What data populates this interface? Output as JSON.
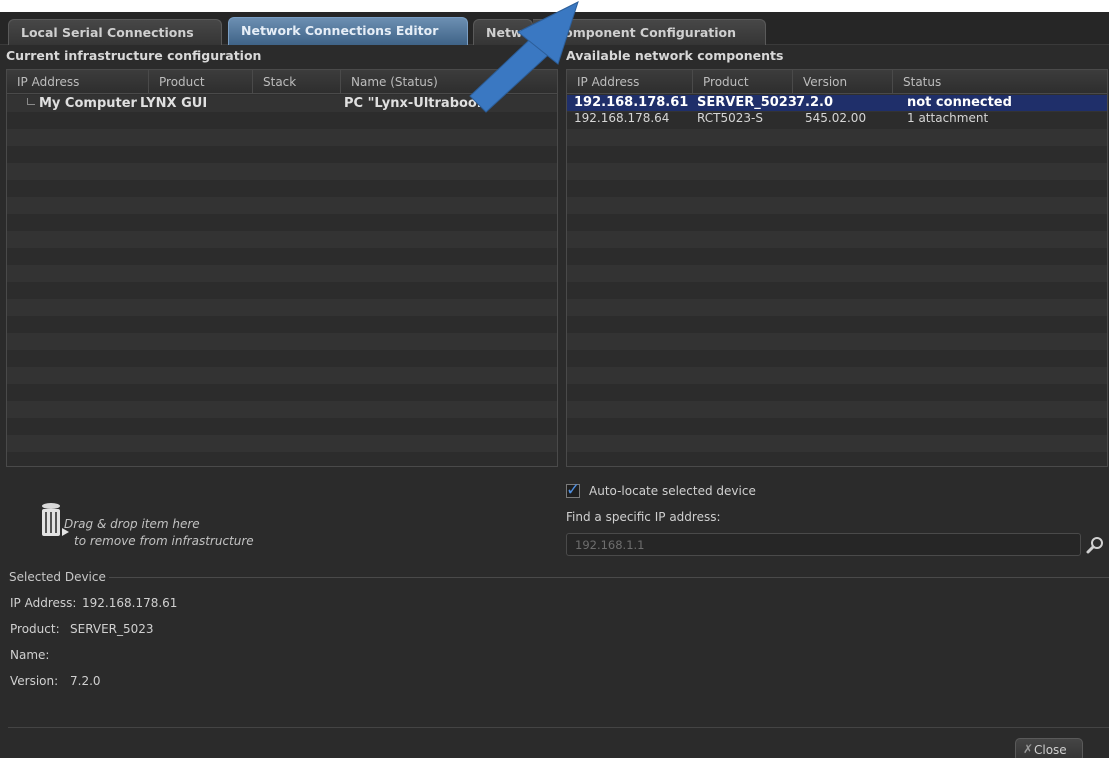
{
  "tabs": [
    {
      "label": "Local Serial Connections",
      "active": false
    },
    {
      "label": "Network Connections Editor",
      "active": true
    },
    {
      "label": "Netw",
      "active": false
    },
    {
      "label": "Component Configuration",
      "active": false
    }
  ],
  "left_panel": {
    "title": "Current infrastructure configuration",
    "columns": [
      "IP Address",
      "Product",
      "Stack",
      "Name (Status)"
    ],
    "rows": [
      {
        "ip": "My Computer",
        "product": "LYNX GUI",
        "stack": "",
        "name": "PC \"Lynx-Ultrabook\""
      }
    ]
  },
  "right_panel": {
    "title": "Available network components",
    "columns": [
      "IP Address",
      "Product",
      "Version",
      "Status"
    ],
    "rows": [
      {
        "ip": "192.168.178.61",
        "product": "SERVER_5023",
        "version": "7.2.0",
        "status": "not connected",
        "selected": true
      },
      {
        "ip": "192.168.178.64",
        "product": "RCT5023-S",
        "version": "545.02.00",
        "status": "1 attachment",
        "selected": false
      }
    ]
  },
  "drop_hint": {
    "line1": "Drag & drop item here",
    "line2": "to remove from infrastructure"
  },
  "auto_locate": {
    "label": "Auto-locate selected device",
    "checked": true
  },
  "find": {
    "label": "Find a specific IP address:",
    "value": "192.168.1.1"
  },
  "selected_device": {
    "title": "Selected Device",
    "fields": [
      {
        "label": "IP Address:",
        "value": "192.168.178.61"
      },
      {
        "label": "Product:",
        "value": "SERVER_5023"
      },
      {
        "label": "Name:",
        "value": ""
      },
      {
        "label": "Version:",
        "value": "7.2.0"
      }
    ]
  },
  "close_label": "Close",
  "colors": {
    "accent": "#3f6387",
    "selection": "#1f2f6a",
    "arrow": "#3a78c2",
    "checkmark": "#4f8fe0"
  }
}
